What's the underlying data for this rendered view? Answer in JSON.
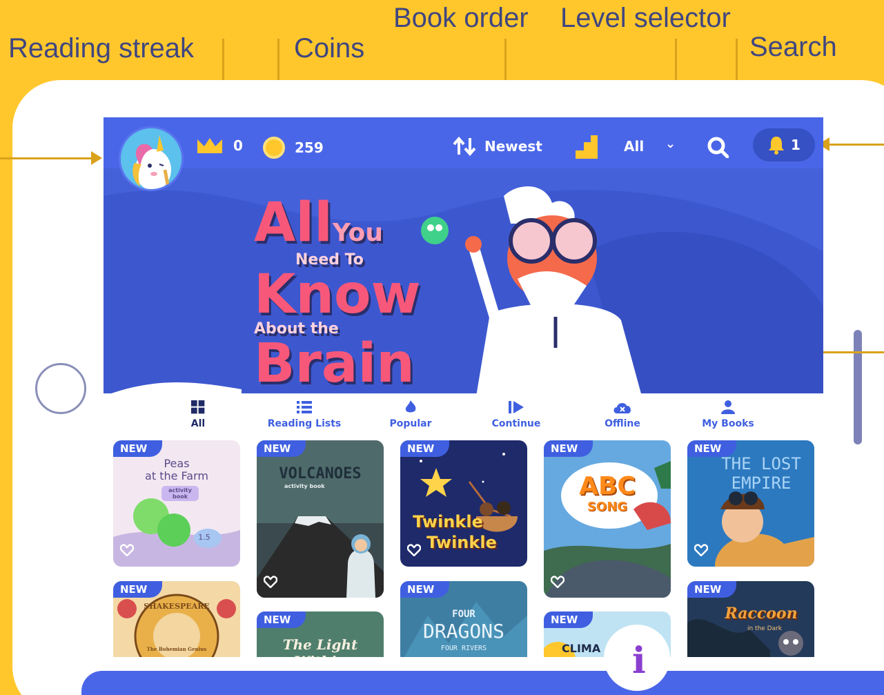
{
  "callouts": {
    "reading_streak": "Reading streak",
    "coins": "Coins",
    "book_order": "Book order",
    "level_selector": "Level selector",
    "search": "Search"
  },
  "topbar": {
    "streak_count": "0",
    "coin_count": "259",
    "order_label": "Newest",
    "level_value": "All",
    "notification_count": "1"
  },
  "banner": {
    "line1": "All",
    "line1b": "You",
    "line2": "Need To",
    "line3": "Know",
    "line4": "About the",
    "line5": "Brain",
    "slides": 5,
    "active_slide": 1
  },
  "categories": [
    {
      "label": "All",
      "icon": "grid-icon",
      "active": true
    },
    {
      "label": "Reading Lists",
      "icon": "list-icon",
      "active": false
    },
    {
      "label": "Popular",
      "icon": "fire-icon",
      "active": false
    },
    {
      "label": "Continue",
      "icon": "play-icon",
      "active": false
    },
    {
      "label": "Offline",
      "icon": "cloud-icon",
      "active": false
    },
    {
      "label": "My Books",
      "icon": "person-icon",
      "active": false
    }
  ],
  "books": {
    "new_tag": "NEW",
    "peas": {
      "title1": "Peas",
      "title2": "at the Farm",
      "sub": "activity book",
      "badge": "1.5"
    },
    "volcanoes": {
      "title": "VOLCANOES",
      "sub": "activity book"
    },
    "twinkle": {
      "title1": "Twinkle",
      "title2": "Twinkle"
    },
    "abc": {
      "title1": "ABC",
      "title2": "SONG"
    },
    "empire": {
      "title1": "THE LOST",
      "title2": "EMPIRE"
    },
    "shakespeare": {
      "title": "SHAKESPEARE",
      "sub": "The Bohemian Genius"
    },
    "lightwithin": {
      "title": "The Light Within"
    },
    "dragons": {
      "title1": "FOUR",
      "title2": "DRAGONS",
      "title3": "FOUR RIVERS"
    },
    "climate": {
      "title": "CLIMA"
    },
    "raccoon": {
      "title": "Raccoon",
      "sub": "in the Dark"
    }
  },
  "colors": {
    "frame": "#FFC72C",
    "primary": "#4A66E8",
    "accent": "#F7587A"
  }
}
